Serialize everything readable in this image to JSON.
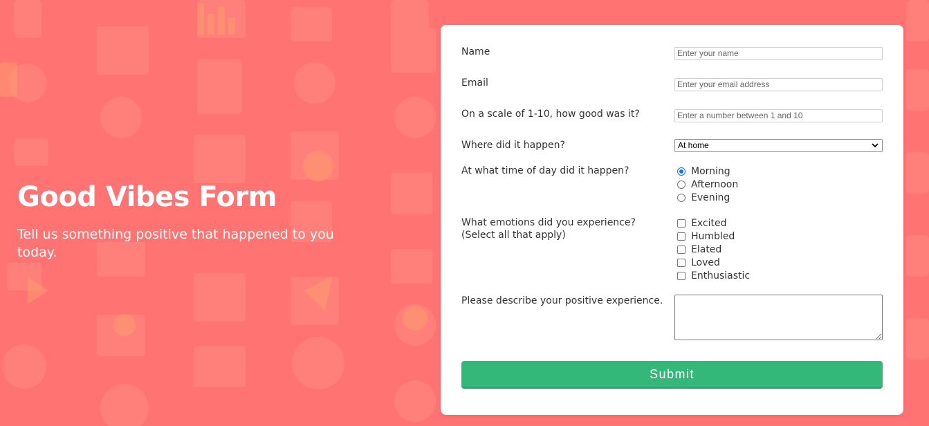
{
  "hero": {
    "title": "Good Vibes Form",
    "subtitle": "Tell us something positive that happened to you today."
  },
  "form": {
    "name": {
      "label": "Name",
      "placeholder": "Enter your name",
      "value": ""
    },
    "email": {
      "label": "Email",
      "placeholder": "Enter your email address",
      "value": ""
    },
    "scale": {
      "label": "On a scale of 1-10, how good was it?",
      "placeholder": "Enter a number between 1 and 10",
      "value": ""
    },
    "where": {
      "label": "Where did it happen?",
      "selected": "At home"
    },
    "time_of_day": {
      "label": "At what time of day did it happen?",
      "options": [
        {
          "label": "Morning",
          "checked": true
        },
        {
          "label": "Afternoon",
          "checked": false
        },
        {
          "label": "Evening",
          "checked": false
        }
      ]
    },
    "emotions": {
      "label": "What emotions did you experience?",
      "sublabel": "(Select all that apply)",
      "options": [
        {
          "label": "Excited",
          "checked": false
        },
        {
          "label": "Humbled",
          "checked": false
        },
        {
          "label": "Elated",
          "checked": false
        },
        {
          "label": "Loved",
          "checked": false
        },
        {
          "label": "Enthusiastic",
          "checked": false
        }
      ]
    },
    "description": {
      "label": "Please describe your positive experience.",
      "value": ""
    },
    "submit_label": "Submit"
  },
  "colors": {
    "background": "#ff7373",
    "card": "#ffffff",
    "submit": "#33b87a",
    "radio_accent": "#1a73e8"
  },
  "icons": {
    "select_chevron": "chevron-down-icon",
    "background_pattern": "business-icons-pattern"
  }
}
